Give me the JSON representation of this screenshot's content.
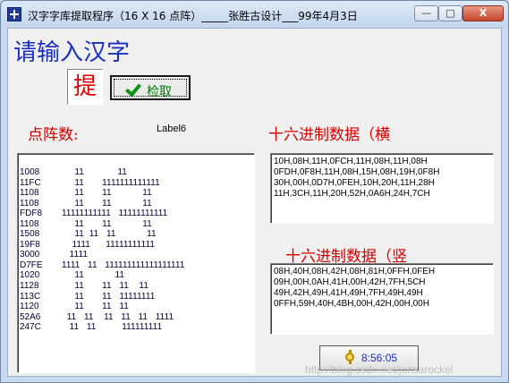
{
  "window": {
    "title": "汉字字库提取程序（16 X 16 点阵）_____张胜古设计___99年4月3日",
    "minimize_label": "—",
    "maximize_label": "□",
    "close_label": "X"
  },
  "main": {
    "heading": "请输入汉字",
    "char_input_value": "提",
    "fetch_button_label": "检取",
    "dot_matrix_label": "点阵数:",
    "label6": "Label6",
    "hex_horizontal_label": "十六进制数据（横",
    "hex_vertical_label": "十六进制数据（竖",
    "clock_time": "8:56:05",
    "watermark": "http://blog.csdn.net/jonsarockel"
  },
  "dot_matrix_rows": [
    {
      "code": "1008",
      "bits": "     11             11"
    },
    {
      "code": "11FC",
      "bits": "     11       1111111111111"
    },
    {
      "code": "1108",
      "bits": "     11       11            11"
    },
    {
      "code": "1108",
      "bits": "     11       11            11"
    },
    {
      "code": "FDF8",
      "bits": "11111111111   11111111111"
    },
    {
      "code": "1108",
      "bits": "     11       11            11"
    },
    {
      "code": "1508",
      "bits": "     11  11   11            11"
    },
    {
      "code": "19F8",
      "bits": "    1111      11111111111"
    },
    {
      "code": "3000",
      "bits": "   1111"
    },
    {
      "code": "D7FE",
      "bits": "1111   11   111111111111111111"
    },
    {
      "code": "1020",
      "bits": "     11            11"
    },
    {
      "code": "1128",
      "bits": "     11       11   11    11"
    },
    {
      "code": "113C",
      "bits": "     11       11   11111111"
    },
    {
      "code": "1120",
      "bits": "     11       11   11"
    },
    {
      "code": "52A6",
      "bits": "  11   11    11   11   11   1111"
    },
    {
      "code": "247C",
      "bits": "   11   11          111111111"
    }
  ],
  "hex_horizontal_lines": [
    "10H,08H,11H,0FCH,11H,08H,11H,08H",
    "0FDH,0F8H,11H,08H,15H,08H,19H,0F8H",
    "30H,00H,0D7H,0FEH,10H,20H,11H,28H",
    "11H,3CH,11H,20H,52H,0A6H,24H,7CH"
  ],
  "hex_vertical_lines": [
    "08H,40H,08H,42H,08H,81H,0FFH,0FEH",
    "09H,00H,0AH,41H,00H,42H,7FH,5CH",
    "49H,42H,49H,41H,49H,7FH,49H,49H",
    "0FFH,59H,40H,4BH,00H,42H,00H,00H"
  ]
}
